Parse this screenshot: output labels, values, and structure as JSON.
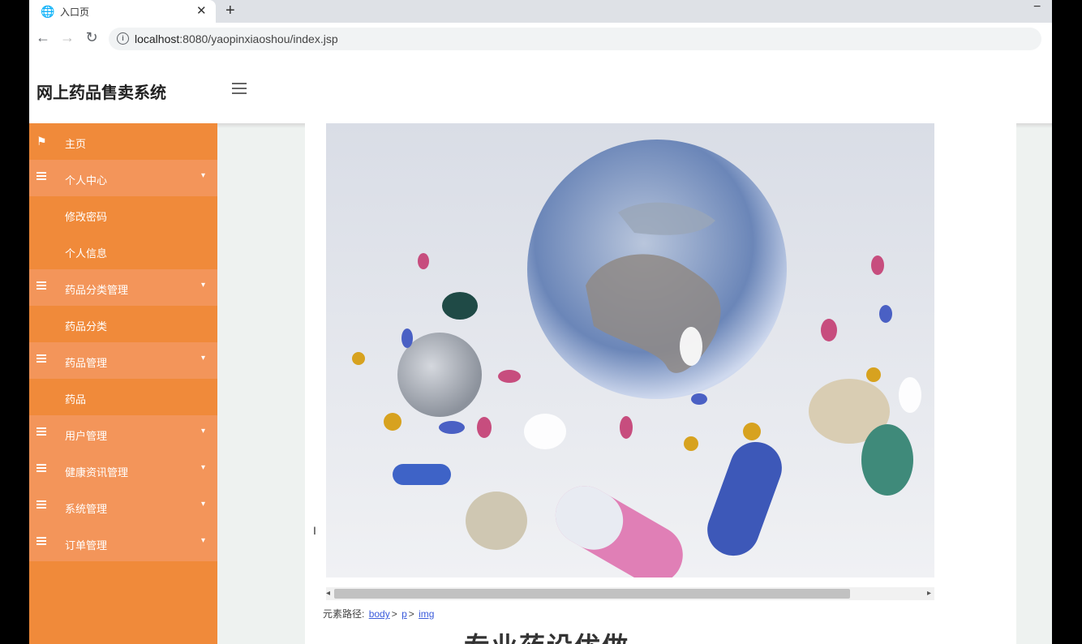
{
  "browser": {
    "tab_title": "入口页",
    "new_tab": "+",
    "close": "✕",
    "minimize": "−",
    "url_host": "localhost",
    "url_rest": ":8080/yaopinxiaoshou/index.jsp",
    "back": "←",
    "forward": "→",
    "reload": "↻"
  },
  "header": {
    "brand": "网上药品售卖系统"
  },
  "sidebar": {
    "items": [
      {
        "label": "主页",
        "type": "home",
        "icon": "flag-icon"
      },
      {
        "label": "个人中心",
        "type": "parent",
        "icon": "list-icon"
      },
      {
        "label": "修改密码",
        "type": "sub"
      },
      {
        "label": "个人信息",
        "type": "sub"
      },
      {
        "label": "药品分类管理",
        "type": "parent",
        "icon": "list-icon"
      },
      {
        "label": "药品分类",
        "type": "sub"
      },
      {
        "label": "药品管理",
        "type": "parent",
        "icon": "list-icon"
      },
      {
        "label": "药品",
        "type": "sub"
      },
      {
        "label": "用户管理",
        "type": "parent",
        "icon": "list-icon"
      },
      {
        "label": "健康资讯管理",
        "type": "parent",
        "icon": "list-icon"
      },
      {
        "label": "系统管理",
        "type": "parent",
        "icon": "list-icon"
      },
      {
        "label": "订单管理",
        "type": "parent",
        "icon": "list-icon"
      }
    ]
  },
  "content": {
    "path_prefix": "元素路径:",
    "path_body": "body",
    "path_p": "p",
    "path_img": "img",
    "headline": "专业药设优做"
  },
  "colors": {
    "sidebar": "#f08a3a",
    "sidebar_parent": "#f3955a"
  }
}
